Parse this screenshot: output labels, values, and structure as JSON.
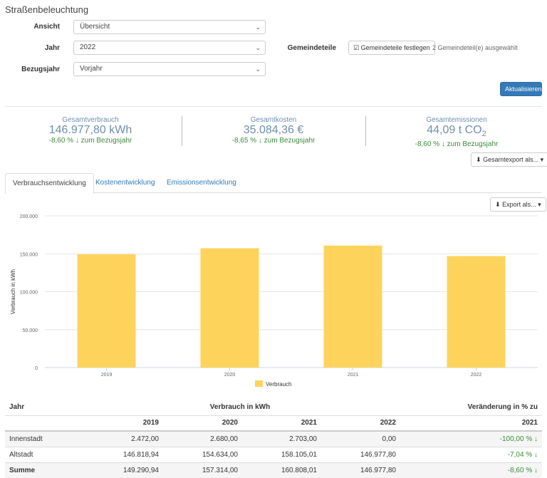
{
  "page": {
    "title": "Straßenbeleuchtung"
  },
  "filters": {
    "ansicht_label": "Ansicht",
    "ansicht_value": "Übersicht",
    "jahr_label": "Jahr",
    "jahr_value": "2022",
    "bezugsjahr_label": "Bezugsjahr",
    "bezugsjahr_value": "Vorjahr",
    "gemeindeteile_label": "Gemeindeteile",
    "gemeindeteile_button": "Gemeindeteile festlegen",
    "gemeindeteile_status": "2 Gemeindeteil(e) ausgewählt",
    "refresh_button": "Aktualisieren"
  },
  "kpis": [
    {
      "label": "Gesamtverbrauch",
      "value": "146.977,80 kWh",
      "change_value": "-8,60 %",
      "change_text": "zum Bezugsjahr"
    },
    {
      "label": "Gesamtkosten",
      "value": "35.084,36 €",
      "change_value": "-8,65 %",
      "change_text": "zum Bezugsjahr"
    },
    {
      "label": "Gesamtemissionen",
      "value_main": "44,09 t CO",
      "value_sub": "2",
      "change_value": "-8,60 %",
      "change_text": "zum Bezugsjahr"
    }
  ],
  "export_all_button": "Gesamtexport als...",
  "tabs": [
    "Verbrauchsentwicklung",
    "Kostenentwicklung",
    "Emissionsentwicklung"
  ],
  "active_tab": "Verbrauchsentwicklung",
  "export_button": "Export als...",
  "colors": {
    "bar": "#fdd35c",
    "positive_change": "#3c8a3c",
    "primary": "#337ab7",
    "kpi_text": "#6f8fae"
  },
  "icons": {
    "arrow_down": "↓",
    "checkbox": "☑",
    "download": "⬇",
    "caret": "▾"
  },
  "chart_data": {
    "type": "bar",
    "categories": [
      "2019",
      "2020",
      "2021",
      "2022"
    ],
    "series": [
      {
        "name": "Verbrauch",
        "values": [
          149290.94,
          157314.0,
          160808.01,
          146977.8
        ]
      }
    ],
    "ylabel": "Verbrauch in kWh",
    "ylim": [
      0,
      200000
    ],
    "yticks": [
      0,
      50000,
      100000,
      150000,
      200000
    ],
    "ytick_labels": [
      "0",
      "50.000",
      "100.000",
      "150.000",
      "200.000"
    ],
    "legend": "bottom",
    "grid": true
  },
  "table": {
    "col_jahr": "Jahr",
    "col_verbrauch": "Verbrauch in kWh",
    "col_change": "Veränderung in % zu",
    "years": [
      "2019",
      "2020",
      "2021",
      "2022"
    ],
    "change_year": "2021",
    "rows": [
      {
        "name": "Innenstadt",
        "values": [
          "2.472,00",
          "2.680,00",
          "2.703,00",
          "0,00"
        ],
        "change": "-100,00 %"
      },
      {
        "name": "Altstadt",
        "values": [
          "146.818,94",
          "154.634,00",
          "158.105,01",
          "146.977,80"
        ],
        "change": "-7,04 %"
      }
    ],
    "total": {
      "name": "Summe",
      "values": [
        "149.290,94",
        "157.314,00",
        "160.808,01",
        "146.977,80"
      ],
      "change": "-8,60 %"
    }
  }
}
